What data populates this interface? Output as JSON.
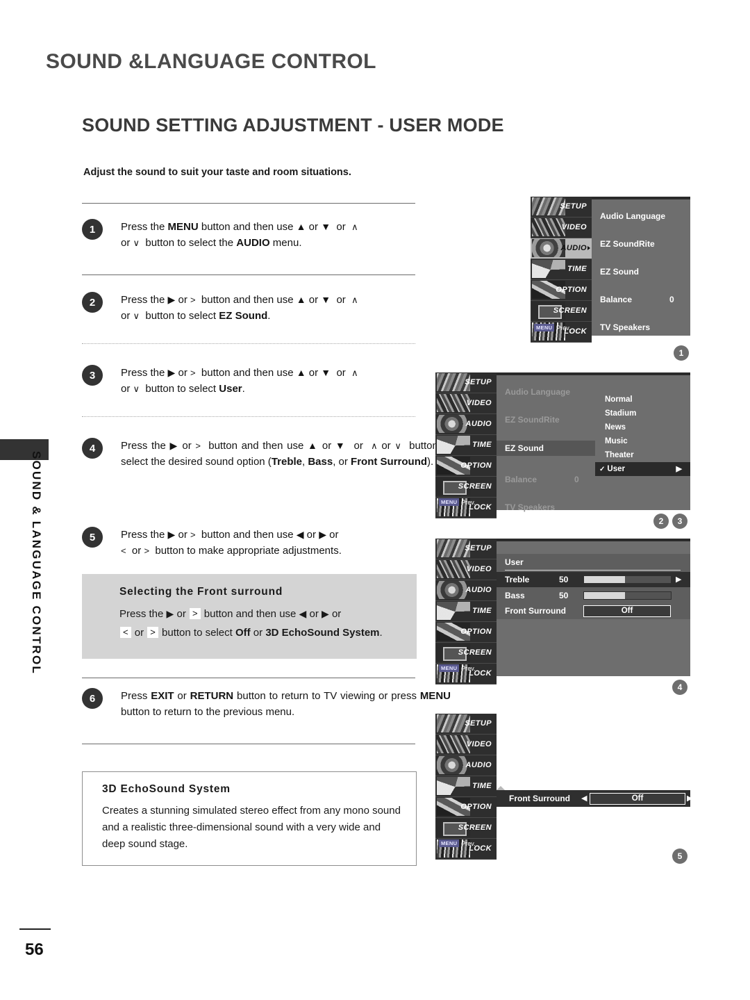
{
  "edge_tab_label": "SOUND & LANGUAGE CONTROL",
  "chapter_title": "SOUND &LANGUAGE CONTROL",
  "section_title": "SOUND SETTING ADJUSTMENT - USER MODE",
  "intro": "Adjust the sound to suit your taste and room situations.",
  "page_number": "56",
  "steps": [
    {
      "num": "1",
      "html": "Press the <b>MENU</b> button and then use <span class=\"symb\">▲</span> or <span class=\"symb\">▼</span>&nbsp; or &nbsp;<span class=\"sym\">∧</span><br>or <span class=\"sym\">∨</span>&nbsp; button to select the <b>AUDIO</b> menu."
    },
    {
      "num": "2",
      "html": "Press the <span class=\"symb\">▶</span> or <span class=\"sym\">&gt;</span>&nbsp; button and then use <span class=\"symb\">▲</span> or <span class=\"symb\">▼</span>&nbsp; or &nbsp;<span class=\"sym\">∧</span><br>or <span class=\"sym\">∨</span>&nbsp; button to select <b>EZ&nbsp;Sound</b>."
    },
    {
      "num": "3",
      "html": "Press the <span class=\"symb\">▶</span> or <span class=\"sym\">&gt;</span>&nbsp; button and then use <span class=\"symb\">▲</span> or <span class=\"symb\">▼</span>&nbsp; or &nbsp;<span class=\"sym\">∧</span><br>or <span class=\"sym\">∨</span>&nbsp; button to select <b>User</b>."
    },
    {
      "num": "4",
      "html": "Press the <span class=\"symb\">▶</span> or <span class=\"sym\">&gt;</span>&nbsp; button and then use <span class=\"symb\">▲</span> or <span class=\"symb\">▼</span>&nbsp; or &nbsp;<span class=\"sym\">∧</span> or <span class=\"sym\">∨</span>&nbsp;&nbsp;button to select the desired sound option (<b>Treble</b>, <b>Bass</b>, or <b>Front&nbsp;Surround</b>)."
    },
    {
      "num": "5",
      "html": "Press the <span class=\"symb\">▶</span> or <span class=\"sym\">&gt;</span>&nbsp; button and then use <span class=\"symb\">◀</span> or <span class=\"symb\">▶</span> or<br><span class=\"sym\">&lt;</span>&nbsp; or <span class=\"sym\">&gt;</span>&nbsp; button to make appropriate adjustments."
    },
    {
      "num": "6",
      "html": "Press <b>EXIT</b> or <b>RETURN</b> button to return to TV viewing or press <b>MENU</b> button to return to the previous menu."
    }
  ],
  "grey_box": {
    "title": "Selecting the Front surround",
    "body_html": "Press the <span class=\"symb\">▶</span> or <span class=\"keycap\">&gt;</span> button and then use <span class=\"symb\">◀</span> or <span class=\"symb\">▶</span> or<br><span class=\"keycap\">&lt;</span> or <span class=\"keycap\">&gt;</span> button to select <b>Off</b> or <b>3D&nbsp;EchoSound System</b>."
  },
  "note_box": {
    "title": "3D EchoSound System",
    "body": "Creates a stunning simulated stereo effect from any mono sound and a realistic three-dimensional sound with a very wide and deep sound stage."
  },
  "osd": {
    "side_items": [
      "SETUP",
      "VIDEO",
      "AUDIO",
      "TIME",
      "OPTION",
      "SCREEN",
      "LOCK"
    ],
    "footer_key": "MENU",
    "footer_label": "Prev.",
    "menu1": {
      "rows": [
        "Audio Language",
        "EZ SoundRite",
        "EZ Sound",
        "Balance",
        "TV Speakers"
      ],
      "balance_value": "0",
      "active_side": "AUDIO"
    },
    "menu2": {
      "rows": [
        "Audio Language",
        "EZ SoundRite",
        "EZ Sound",
        "Balance",
        "TV Speakers"
      ],
      "balance_value": "0",
      "selected_row": "EZ Sound",
      "options": [
        "Normal",
        "Stadium",
        "News",
        "Music",
        "Theater",
        "User"
      ],
      "selected_option": "User",
      "check_mark": "✓"
    },
    "menu3": {
      "header": "User",
      "treble_label": "Treble",
      "treble_value": "50",
      "bass_label": "Bass",
      "bass_value": "50",
      "front_surround_label": "Front Surround",
      "front_surround_value": "Off"
    },
    "menu4": {
      "label": "Front Surround",
      "value": "Off"
    }
  },
  "ref_badges": [
    "1",
    "2",
    "3",
    "4",
    "5"
  ]
}
